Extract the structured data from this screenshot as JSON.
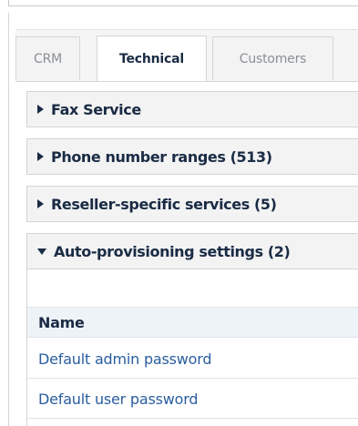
{
  "tabs": [
    {
      "label": "CRM",
      "active": false
    },
    {
      "label": "Technical",
      "active": true
    },
    {
      "label": "Customers",
      "active": false
    }
  ],
  "sections": [
    {
      "label": "Fax Service",
      "expanded": false
    },
    {
      "label": "Phone number ranges (513)",
      "expanded": false
    },
    {
      "label": "Reseller-specific services (5)",
      "expanded": false
    },
    {
      "label": "Auto-provisioning settings (2)",
      "expanded": true
    }
  ],
  "auto_provisioning_table": {
    "header": "Name",
    "rows": [
      "Default admin password",
      "Default user password"
    ]
  },
  "colors": {
    "text_dark": "#1a2b44",
    "link_blue": "#2a5d9f",
    "tab_inactive_text": "#8a8f96",
    "section_bg": "#f3f3f3",
    "table_header_bg": "#eef3f8"
  }
}
